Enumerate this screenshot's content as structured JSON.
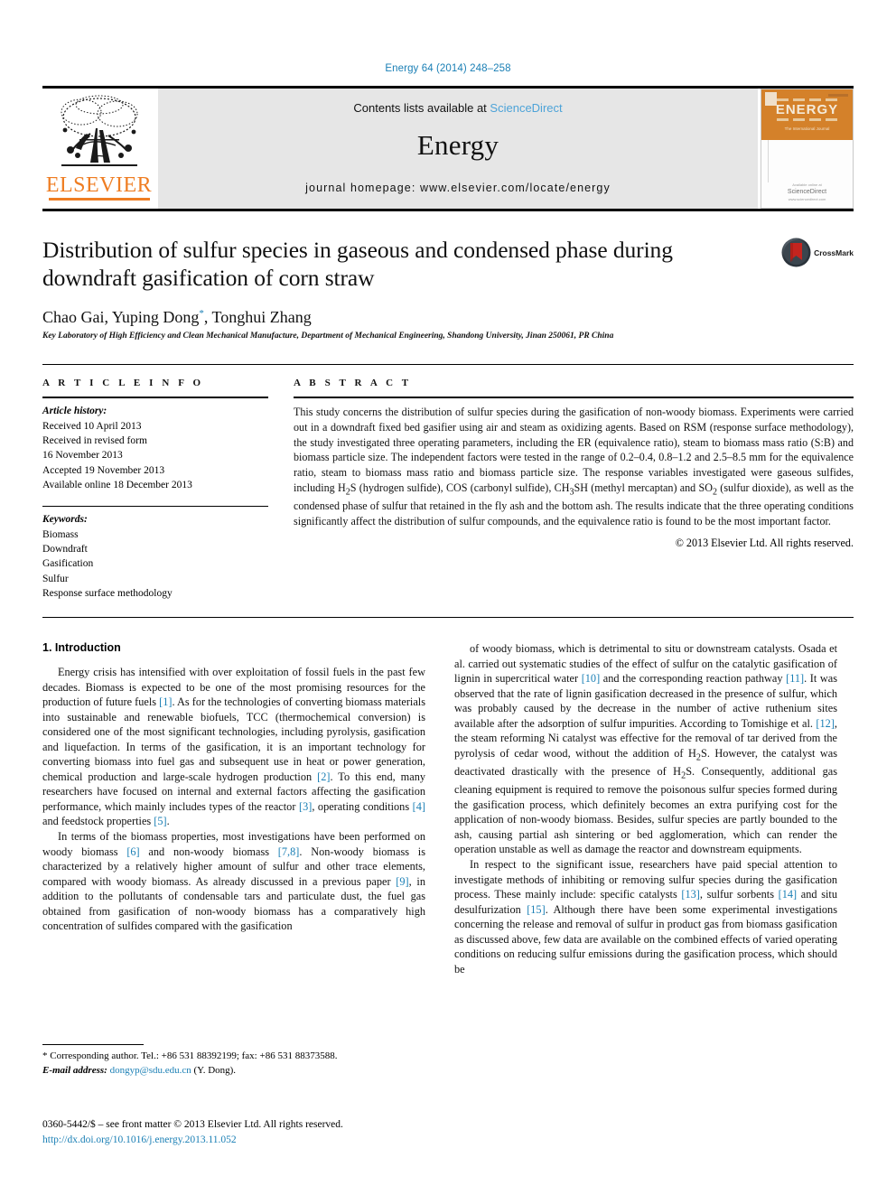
{
  "running_head": "Energy 64 (2014) 248–258",
  "masthead": {
    "publisher_name": "ELSEVIER",
    "contents_prefix": "Contents lists available at",
    "contents_link": "ScienceDirect",
    "journal_name": "Energy",
    "homepage": "journal homepage: www.elsevier.com/locate/energy",
    "cover": {
      "title": "ENERGY",
      "subtitle": "The International Journal",
      "foot_line1": "Available online at",
      "foot_line2": "ScienceDirect",
      "foot_line3": "www.sciencedirect.com"
    }
  },
  "article": {
    "title": "Distribution of sulfur species in gaseous and condensed phase during downdraft gasification of corn straw",
    "crossmark_label": "CrossMark",
    "authors": "Chao Gai, Yuping Dong",
    "authors_tail": ", Tonghui Zhang",
    "corresponding_marker": "*",
    "affiliation": "Key Laboratory of High Efficiency and Clean Mechanical Manufacture, Department of Mechanical Engineering, Shandong University, Jinan 250061, PR China"
  },
  "info": {
    "heading": "A R T I C L E   I N F O",
    "history_label": "Article history:",
    "history": [
      "Received 10 April 2013",
      "Received in revised form",
      "16 November 2013",
      "Accepted 19 November 2013",
      "Available online 18 December 2013"
    ],
    "keywords_label": "Keywords:",
    "keywords": [
      "Biomass",
      "Downdraft",
      "Gasification",
      "Sulfur",
      "Response surface methodology"
    ]
  },
  "abstract": {
    "heading": "A B S T R A C T",
    "text": "This study concerns the distribution of sulfur species during the gasification of non-woody biomass. Experiments were carried out in a downdraft fixed bed gasifier using air and steam as oxidizing agents. Based on RSM (response surface methodology), the study investigated three operating parameters, including the ER (equivalence ratio), steam to biomass mass ratio (S:B) and biomass particle size. The independent factors were tested in the range of 0.2–0.4, 0.8–1.2 and 2.5–8.5 mm for the equivalence ratio, steam to biomass mass ratio and biomass particle size. The response variables investigated were gaseous sulfides, including H2S (hydrogen sulfide), COS (carbonyl sulfide), CH3SH (methyl mercaptan) and SO2 (sulfur dioxide), as well as the condensed phase of sulfur that retained in the fly ash and the bottom ash. The results indicate that the three operating conditions significantly affect the distribution of sulfur compounds, and the equivalence ratio is found to be the most important factor.",
    "copyright": "© 2013 Elsevier Ltd. All rights reserved."
  },
  "body": {
    "section_heading": "1.  Introduction",
    "left_paragraphs": [
      "Energy crisis has intensified with over exploitation of fossil fuels in the past few decades. Biomass is expected to be one of the most promising resources for the production of future fuels [1]. As for the technologies of converting biomass materials into sustainable and renewable biofuels, TCC (thermochemical conversion) is considered one of the most significant technologies, including pyrolysis, gasification and liquefaction. In terms of the gasification, it is an important technology for converting biomass into fuel gas and subsequent use in heat or power generation, chemical production and large-scale hydrogen production [2]. To this end, many researchers have focused on internal and external factors affecting the gasification performance, which mainly includes types of the reactor [3], operating conditions [4] and feedstock properties [5].",
      "In terms of the biomass properties, most investigations have been performed on woody biomass [6] and non-woody biomass [7,8]. Non-woody biomass is characterized by a relatively higher amount of sulfur and other trace elements, compared with woody biomass. As already discussed in a previous paper [9], in addition to the pollutants of condensable tars and particulate dust, the fuel gas obtained from gasification of non-woody biomass has a comparatively high concentration of sulfides compared with the gasification"
    ],
    "right_paragraphs": [
      "of woody biomass, which is detrimental to situ or downstream catalysts. Osada et al. carried out systematic studies of the effect of sulfur on the catalytic gasification of lignin in supercritical water [10] and the corresponding reaction pathway [11]. It was observed that the rate of lignin gasification decreased in the presence of sulfur, which was probably caused by the decrease in the number of active ruthenium sites available after the adsorption of sulfur impurities. According to Tomishige et al. [12], the steam reforming Ni catalyst was effective for the removal of tar derived from the pyrolysis of cedar wood, without the addition of H2S. However, the catalyst was deactivated drastically with the presence of H2S. Consequently, additional gas cleaning equipment is required to remove the poisonous sulfur species formed during the gasification process, which definitely becomes an extra purifying cost for the application of non-woody biomass. Besides, sulfur species are partly bounded to the ash, causing partial ash sintering or bed agglomeration, which can render the operation unstable as well as damage the reactor and downstream equipments.",
      "In respect to the significant issue, researchers have paid special attention to investigate methods of inhibiting or removing sulfur species during the gasification process. These mainly include: specific catalysts [13], sulfur sorbents [14] and situ desulfurization [15]. Although there have been some experimental investigations concerning the release and removal of sulfur in product gas from biomass gasification as discussed above, few data are available on the combined effects of varied operating conditions on reducing sulfur emissions during the gasification process, which should be"
    ]
  },
  "footnotes": {
    "corresponding": "* Corresponding author. Tel.: +86 531 88392199; fax: +86 531 88373588.",
    "email_label": "E-mail address:",
    "email": "dongyp@sdu.edu.cn",
    "email_tail": "(Y. Dong).",
    "issn_line": "0360-5442/$ – see front matter © 2013 Elsevier Ltd. All rights reserved.",
    "doi": "http://dx.doi.org/10.1016/j.energy.2013.11.052"
  },
  "colors": {
    "link": "#1a7fb5",
    "elsevier_orange": "#ef7d22",
    "cover_orange": "#d4812a",
    "masthead_grey": "#e6e6e6"
  }
}
